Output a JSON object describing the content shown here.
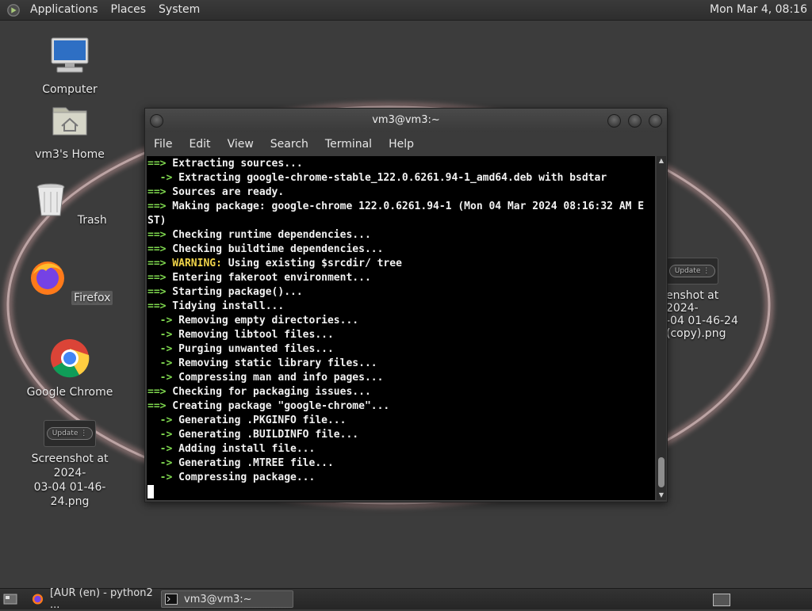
{
  "top_panel": {
    "menus": [
      "Applications",
      "Places",
      "System"
    ],
    "clock": "Mon Mar  4, 08:16"
  },
  "desktop": {
    "icons": [
      {
        "label": "Computer",
        "icon": "computer-icon"
      },
      {
        "label": "vm3's Home",
        "icon": "home-folder-icon"
      },
      {
        "label": "Trash",
        "icon": "trash-icon"
      },
      {
        "label": "Firefox",
        "icon": "firefox-icon"
      },
      {
        "label": "Google Chrome",
        "icon": "chrome-icon"
      },
      {
        "label_line1": "Screenshot at 2024-",
        "label_line2": "03-04 01-46-24.png",
        "icon": "screenshot-thumbnail",
        "thumb_text": "Update ⋮"
      }
    ],
    "right_icon": {
      "line1": "enshot at 2024-",
      "line2": "-04 01-46-24",
      "line3": "(copy).png",
      "thumb_text": "Update ⋮"
    }
  },
  "terminal": {
    "title": "vm3@vm3:~",
    "menus": [
      "File",
      "Edit",
      "View",
      "Search",
      "Terminal",
      "Help"
    ],
    "lines": [
      {
        "prefix": "==>",
        "color": "g",
        "text": " Extracting sources..."
      },
      {
        "prefix": "  ->",
        "color": "g",
        "text": " Extracting google-chrome-stable_122.0.6261.94-1_amd64.deb with bsdtar"
      },
      {
        "prefix": "==>",
        "color": "g",
        "text": " Sources are ready."
      },
      {
        "prefix": "==>",
        "color": "g",
        "text": " Making package: google-chrome 122.0.6261.94-1 (Mon 04 Mar 2024 08:16:32 AM E"
      },
      {
        "prefix": "",
        "color": "g",
        "text": "ST)"
      },
      {
        "prefix": "==>",
        "color": "g",
        "text": " Checking runtime dependencies..."
      },
      {
        "prefix": "==>",
        "color": "g",
        "text": " Checking buildtime dependencies..."
      },
      {
        "prefix": "==>",
        "color": "g",
        "warn": "WARNING:",
        "text": " Using existing $srcdir/ tree"
      },
      {
        "prefix": "==>",
        "color": "g",
        "text": " Entering fakeroot environment..."
      },
      {
        "prefix": "==>",
        "color": "g",
        "text": " Starting package()..."
      },
      {
        "prefix": "==>",
        "color": "g",
        "text": " Tidying install..."
      },
      {
        "prefix": "  ->",
        "color": "b",
        "text": " Removing empty directories..."
      },
      {
        "prefix": "  ->",
        "color": "b",
        "text": " Removing libtool files..."
      },
      {
        "prefix": "  ->",
        "color": "b",
        "text": " Purging unwanted files..."
      },
      {
        "prefix": "  ->",
        "color": "b",
        "text": " Removing static library files..."
      },
      {
        "prefix": "  ->",
        "color": "b",
        "text": " Compressing man and info pages..."
      },
      {
        "prefix": "==>",
        "color": "g",
        "text": " Checking for packaging issues..."
      },
      {
        "prefix": "==>",
        "color": "g",
        "text": " Creating package \"google-chrome\"..."
      },
      {
        "prefix": "  ->",
        "color": "b",
        "text": " Generating .PKGINFO file..."
      },
      {
        "prefix": "  ->",
        "color": "b",
        "text": " Generating .BUILDINFO file..."
      },
      {
        "prefix": "  ->",
        "color": "b",
        "text": " Adding install file..."
      },
      {
        "prefix": "  ->",
        "color": "b",
        "text": " Generating .MTREE file..."
      },
      {
        "prefix": "  ->",
        "color": "b",
        "text": " Compressing package..."
      }
    ]
  },
  "taskbar": {
    "tasks": [
      {
        "label": "[AUR (en) - python2 ...",
        "icon": "firefox-icon"
      },
      {
        "label": "vm3@vm3:~",
        "icon": "terminal-icon"
      }
    ]
  },
  "colors": {
    "accent_green": "#7fd84f",
    "warning_yellow": "#f0d44a",
    "panel": "#2e2e2e"
  }
}
